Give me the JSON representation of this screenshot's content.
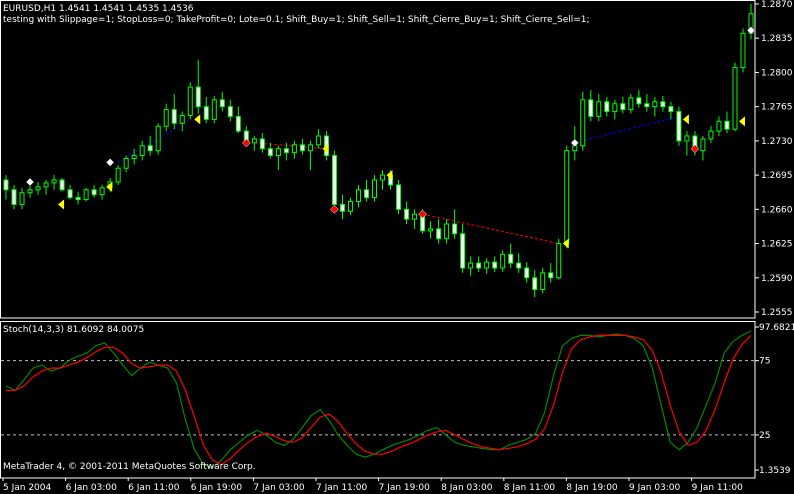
{
  "symbol_header": "EURUSD,H1  1.4541 1.4541 1.4535 1.4536",
  "test_params": "testing with Slippage=1; StopLoss=0; TakeProfit=0; Lote=0.1; Shift_Buy=1; Shift_Sell=1; Shift_Cierre_Buy=1; Shift_Cierre_Sell=1;",
  "indicator_header": "Stoch(14,3,3) 81.6092 84.0075",
  "copyright": "MetaTrader 4, © 2001-2011 MetaQuotes Software Corp.",
  "colors": {
    "bull_body": "#000000",
    "bear_body": "#ffffff",
    "candle_line": "#00ff00",
    "stoch_main": "#008800",
    "stoch_signal": "#ff0000",
    "buy_trade_line": "#0000ff",
    "sell_trade_line": "#ff0000",
    "sell_arrow": "#ffff00",
    "close_marker": "#ff0000"
  },
  "chart_data": [
    {
      "type": "candlestick",
      "title": "EURUSD,H1",
      "y_ticks": [
        "1.2870",
        "1.2835",
        "1.2800",
        "1.2765",
        "1.2730",
        "1.2695",
        "1.2660",
        "1.2625",
        "1.2590",
        "1.2555"
      ],
      "ylim": [
        1.2555,
        1.287
      ],
      "candles": [
        [
          1.269,
          1.2695,
          1.267,
          1.268
        ],
        [
          1.268,
          1.2685,
          1.266,
          1.2665
        ],
        [
          1.2665,
          1.2682,
          1.266,
          1.2677
        ],
        [
          1.2677,
          1.2685,
          1.2672,
          1.268
        ],
        [
          1.268,
          1.2688,
          1.2675,
          1.2683
        ],
        [
          1.2683,
          1.269,
          1.2675,
          1.2687
        ],
        [
          1.2687,
          1.2695,
          1.268,
          1.269
        ],
        [
          1.269,
          1.2692,
          1.2678,
          1.268
        ],
        [
          1.268,
          1.2685,
          1.267,
          1.2672
        ],
        [
          1.2672,
          1.2678,
          1.2665,
          1.267
        ],
        [
          1.267,
          1.2682,
          1.2668,
          1.268
        ],
        [
          1.268,
          1.2685,
          1.2672,
          1.2675
        ],
        [
          1.2675,
          1.2685,
          1.267,
          1.2682
        ],
        [
          1.2682,
          1.2692,
          1.2678,
          1.2688
        ],
        [
          1.2688,
          1.2705,
          1.2685,
          1.2702
        ],
        [
          1.2702,
          1.2715,
          1.2698,
          1.2712
        ],
        [
          1.2712,
          1.2722,
          1.2706,
          1.2715
        ],
        [
          1.2715,
          1.273,
          1.271,
          1.2725
        ],
        [
          1.2725,
          1.2735,
          1.2715,
          1.272
        ],
        [
          1.272,
          1.2748,
          1.2716,
          1.2745
        ],
        [
          1.2745,
          1.2768,
          1.274,
          1.2762
        ],
        [
          1.2762,
          1.2778,
          1.2742,
          1.2748
        ],
        [
          1.2748,
          1.276,
          1.274,
          1.2756
        ],
        [
          1.2756,
          1.279,
          1.2752,
          1.2785
        ],
        [
          1.2785,
          1.2813,
          1.2758,
          1.2765
        ],
        [
          1.2765,
          1.2775,
          1.2748,
          1.2752
        ],
        [
          1.2752,
          1.2776,
          1.2748,
          1.2772
        ],
        [
          1.2772,
          1.278,
          1.276,
          1.2765
        ],
        [
          1.2765,
          1.2772,
          1.275,
          1.2755
        ],
        [
          1.2755,
          1.2765,
          1.2738,
          1.274
        ],
        [
          1.274,
          1.2745,
          1.2725,
          1.2728
        ],
        [
          1.2728,
          1.2735,
          1.272,
          1.2732
        ],
        [
          1.2732,
          1.2738,
          1.2718,
          1.2722
        ],
        [
          1.2722,
          1.2728,
          1.2712,
          1.2715
        ],
        [
          1.2715,
          1.2725,
          1.27,
          1.2722
        ],
        [
          1.2722,
          1.2728,
          1.271,
          1.2718
        ],
        [
          1.2718,
          1.273,
          1.2712,
          1.2726
        ],
        [
          1.2726,
          1.2732,
          1.2716,
          1.272
        ],
        [
          1.272,
          1.273,
          1.27,
          1.2726
        ],
        [
          1.2726,
          1.2742,
          1.2722,
          1.2735
        ],
        [
          1.2735,
          1.274,
          1.271,
          1.2715
        ],
        [
          1.2715,
          1.272,
          1.266,
          1.2665
        ],
        [
          1.2665,
          1.2675,
          1.265,
          1.2658
        ],
        [
          1.2658,
          1.2672,
          1.2654,
          1.2668
        ],
        [
          1.2668,
          1.2685,
          1.2662,
          1.268
        ],
        [
          1.268,
          1.269,
          1.2668,
          1.2672
        ],
        [
          1.2672,
          1.2695,
          1.2668,
          1.269
        ],
        [
          1.269,
          1.27,
          1.268,
          1.2695
        ],
        [
          1.2695,
          1.27,
          1.268,
          1.2685
        ],
        [
          1.2685,
          1.269,
          1.2655,
          1.266
        ],
        [
          1.266,
          1.2668,
          1.2645,
          1.265
        ],
        [
          1.265,
          1.266,
          1.264,
          1.2655
        ],
        [
          1.2655,
          1.266,
          1.2635,
          1.2638
        ],
        [
          1.2638,
          1.2648,
          1.263,
          1.264
        ],
        [
          1.264,
          1.265,
          1.2625,
          1.263
        ],
        [
          1.263,
          1.265,
          1.2625,
          1.2645
        ],
        [
          1.2645,
          1.266,
          1.263,
          1.2635
        ],
        [
          1.2635,
          1.2645,
          1.2595,
          1.26
        ],
        [
          1.26,
          1.2612,
          1.2592,
          1.2605
        ],
        [
          1.2605,
          1.2612,
          1.2596,
          1.26
        ],
        [
          1.26,
          1.261,
          1.2594,
          1.2606
        ],
        [
          1.2606,
          1.2612,
          1.2596,
          1.26
        ],
        [
          1.26,
          1.2618,
          1.2596,
          1.2614
        ],
        [
          1.2614,
          1.2625,
          1.26,
          1.2605
        ],
        [
          1.2605,
          1.2615,
          1.2595,
          1.26
        ],
        [
          1.26,
          1.2606,
          1.2585,
          1.259
        ],
        [
          1.259,
          1.2598,
          1.257,
          1.2578
        ],
        [
          1.2578,
          1.26,
          1.2574,
          1.2595
        ],
        [
          1.2595,
          1.2605,
          1.2585,
          1.259
        ],
        [
          1.259,
          1.263,
          1.2588,
          1.2625
        ],
        [
          1.2625,
          1.2725,
          1.262,
          1.272
        ],
        [
          1.272,
          1.2745,
          1.271,
          1.2725
        ],
        [
          1.2725,
          1.278,
          1.272,
          1.2772
        ],
        [
          1.2772,
          1.2782,
          1.275,
          1.2755
        ],
        [
          1.2755,
          1.2778,
          1.275,
          1.277
        ],
        [
          1.277,
          1.2775,
          1.2755,
          1.276
        ],
        [
          1.276,
          1.2772,
          1.2752,
          1.2768
        ],
        [
          1.2768,
          1.2775,
          1.2758,
          1.2762
        ],
        [
          1.2762,
          1.2778,
          1.2758,
          1.2774
        ],
        [
          1.2774,
          1.2782,
          1.2764,
          1.2768
        ],
        [
          1.2768,
          1.2778,
          1.276,
          1.2765
        ],
        [
          1.2765,
          1.2775,
          1.2755,
          1.277
        ],
        [
          1.277,
          1.2776,
          1.276,
          1.2765
        ],
        [
          1.2765,
          1.277,
          1.2752,
          1.276
        ],
        [
          1.276,
          1.2765,
          1.2725,
          1.273
        ],
        [
          1.273,
          1.274,
          1.2715,
          1.2735
        ],
        [
          1.2735,
          1.274,
          1.2715,
          1.272
        ],
        [
          1.272,
          1.2735,
          1.271,
          1.2732
        ],
        [
          1.2732,
          1.2745,
          1.2728,
          1.274
        ],
        [
          1.274,
          1.2755,
          1.2735,
          1.275
        ],
        [
          1.275,
          1.276,
          1.2738,
          1.2742
        ],
        [
          1.2742,
          1.281,
          1.274,
          1.2805
        ],
        [
          1.2805,
          1.2845,
          1.28,
          1.284
        ],
        [
          1.284,
          1.287,
          1.2834,
          1.286
        ]
      ],
      "trades": [
        {
          "kind": "buy",
          "from": 14,
          "to": 23,
          "from_price": 1.2708,
          "to_price": 1.2752
        },
        {
          "kind": "sell",
          "from": 31,
          "to": 40,
          "from_price": 1.2728,
          "to_price": 1.2722
        },
        {
          "kind": "sell",
          "from": 52,
          "to": 69,
          "from_price": 1.2655,
          "to_price": 1.2625
        },
        {
          "kind": "buy",
          "from": 71,
          "to": 84,
          "from_price": 1.2728,
          "to_price": 1.2755
        }
      ],
      "sell_arrows": [
        [
          6,
          1.2665
        ],
        [
          12,
          1.2683
        ],
        [
          23,
          1.2752
        ],
        [
          39,
          1.2722
        ],
        [
          47,
          1.2695
        ],
        [
          69,
          1.2625
        ],
        [
          84,
          1.2752
        ],
        [
          91,
          1.275
        ]
      ],
      "buy_markers": [
        [
          3,
          1.2688
        ],
        [
          13,
          1.2708
        ],
        [
          71,
          1.2728
        ],
        [
          93,
          1.2843
        ]
      ],
      "close_markers": [
        [
          30,
          1.2728
        ],
        [
          41,
          1.266
        ],
        [
          52,
          1.2655
        ],
        [
          86,
          1.2722
        ]
      ]
    },
    {
      "type": "line",
      "title": "Stoch(14,3,3)",
      "ylim": [
        1.3539,
        97.6821
      ],
      "y_ticks": [
        "97.6821",
        "75",
        "25",
        "1.3539"
      ],
      "levels": [
        75,
        25
      ],
      "series": [
        {
          "name": "main",
          "color": "#008800",
          "values": [
            58,
            55,
            62,
            70,
            72,
            68,
            70,
            75,
            78,
            80,
            85,
            87,
            80,
            72,
            65,
            70,
            74,
            72,
            70,
            60,
            35,
            15,
            5,
            3,
            8,
            15,
            20,
            25,
            28,
            25,
            20,
            18,
            22,
            30,
            38,
            42,
            35,
            25,
            18,
            12,
            10,
            12,
            15,
            18,
            20,
            22,
            25,
            28,
            30,
            25,
            20,
            18,
            17,
            16,
            15,
            15,
            18,
            20,
            22,
            26,
            40,
            65,
            85,
            90,
            92,
            92,
            91,
            92,
            93,
            92,
            90,
            85,
            70,
            45,
            20,
            15,
            20,
            30,
            45,
            60,
            80,
            88,
            92,
            95
          ]
        },
        {
          "name": "signal",
          "color": "#ff0000",
          "values": [
            55,
            55,
            58,
            64,
            68,
            70,
            70,
            72,
            74,
            77,
            81,
            84,
            84,
            80,
            73,
            70,
            71,
            72,
            72,
            68,
            55,
            37,
            18,
            8,
            5,
            9,
            15,
            20,
            24,
            26,
            24,
            21,
            20,
            23,
            30,
            37,
            39,
            34,
            26,
            19,
            14,
            12,
            12,
            14,
            17,
            19,
            22,
            25,
            27,
            28,
            25,
            22,
            19,
            17,
            16,
            15,
            16,
            17,
            19,
            22,
            29,
            45,
            67,
            83,
            89,
            91,
            92,
            92,
            92,
            92,
            91,
            89,
            82,
            67,
            45,
            27,
            18,
            20,
            28,
            42,
            60,
            76,
            86,
            92
          ]
        }
      ]
    }
  ],
  "x_axis_labels": [
    "5 Jan 2004",
    "6 Jan 03:00",
    "6 Jan 11:00",
    "6 Jan 19:00",
    "7 Jan 03:00",
    "7 Jan 11:00",
    "7 Jan 19:00",
    "8 Jan 03:00",
    "8 Jan 11:00",
    "8 Jan 19:00",
    "9 Jan 03:00",
    "9 Jan 11:00"
  ]
}
